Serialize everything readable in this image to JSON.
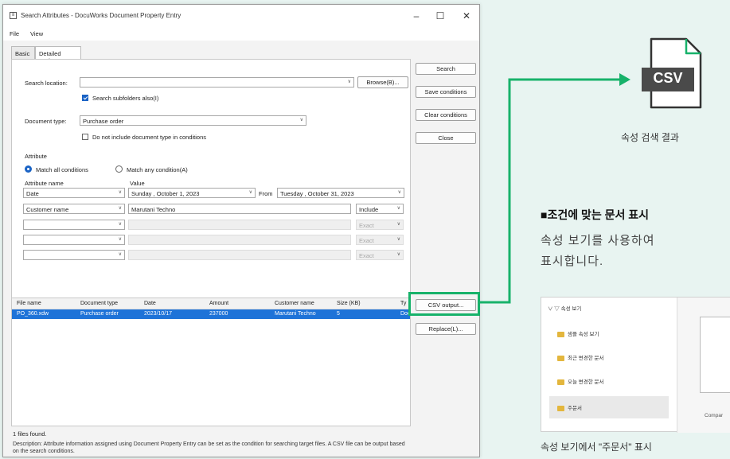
{
  "window": {
    "title": "Search Attributes - DocuWorks Document Property Entry",
    "controls": {
      "minimize": "–",
      "maximize": "☐",
      "close": "✕"
    }
  },
  "menu": [
    "File",
    "View"
  ],
  "tabs": [
    "Basic",
    "Detailed settings"
  ],
  "search": {
    "location_label": "Search location:",
    "location_value": "",
    "browse_label": "Browse(B)...",
    "subfolders_label": "Search subfolders also(I)",
    "subfolders_checked": true,
    "doctype_label": "Document type:",
    "doctype_value": "Purchase order",
    "exclude_doctype_label": "Do not include document type in conditions",
    "exclude_doctype_checked": false
  },
  "attribute": {
    "group_label": "Attribute",
    "match_all_label": "Match all conditions",
    "match_any_label": "Match any condition(A)",
    "name_header": "Attribute name",
    "value_header": "Value",
    "rows": [
      {
        "name": "Date",
        "value_from": "Sunday  ,  October   1, 2023",
        "range_label": "From",
        "value_to": "Tuesday  ,  October  31, 2023"
      },
      {
        "name": "Customer name",
        "value": "Marutani Techno",
        "op": "Include"
      },
      {
        "name": "",
        "value": "",
        "op": "Exact"
      },
      {
        "name": "",
        "value": "",
        "op": "Exact"
      },
      {
        "name": "",
        "value": "",
        "op": "Exact"
      }
    ]
  },
  "buttons": {
    "search": "Search",
    "save_conditions": "Save conditions",
    "clear_conditions": "Clear conditions",
    "close": "Close",
    "csv_output": "CSV output...",
    "replace": "Replace(L)..."
  },
  "results": {
    "columns": [
      "File name",
      "Document type",
      "Date",
      "Amount",
      "Customer name",
      "Size (KB)",
      "Ty"
    ],
    "rows": [
      [
        "PO_360.xdw",
        "Purchase order",
        "2023/10/17",
        "237000",
        "Marutani Techno",
        "5",
        "Doc"
      ]
    ]
  },
  "status": "1 files found.",
  "description": "Description: Attribute information assigned using Document Property Entry can be set as the condition for searching target files. A CSV file can be output based on the search conditions.",
  "annotation": {
    "csv_badge": "CSV",
    "csv_caption": "속성 검색 결과",
    "section_title": "■조건에 맞는 문서 표시",
    "section_text": [
      "속성 보기를 사용하여",
      "표시합니다."
    ],
    "preview_items": [
      "속성 보기",
      "샘플 속성 보기",
      "최근 변경한 문서",
      "오늘 변경한 문서",
      "주문서"
    ],
    "preview_thumb_caption": "Compar",
    "preview_caption": "속성 보기에서 \"주문서\" 표시"
  },
  "colors": {
    "accent": "#1a63c5",
    "highlight": "#17b26a",
    "csv_badge": "#4a4a4a",
    "background": "#e8f4f1"
  }
}
